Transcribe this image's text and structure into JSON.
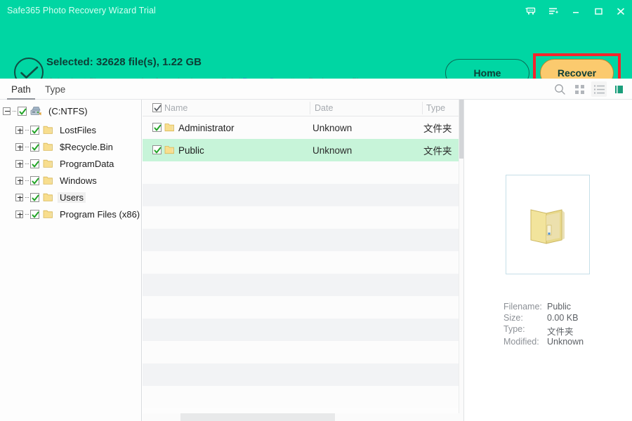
{
  "window": {
    "title": "Safe365 Photo Recovery Wizard Trial",
    "controls": [
      {
        "name": "cart-icon",
        "label": "Cart"
      },
      {
        "name": "feedback-icon",
        "label": "Feedback"
      },
      {
        "name": "minimize-icon",
        "label": "Minimize"
      },
      {
        "name": "maximize-icon",
        "label": "Maximize"
      },
      {
        "name": "close-icon",
        "label": "Close"
      }
    ],
    "accent_color": "#00d6a3",
    "highlight_color": "#f5232b"
  },
  "header": {
    "status_icon": "check-circle-icon",
    "selected_text": "Selected: 32628 file(s), 1.22 GB",
    "hint_prefix": "If the lost files cannot be found, please click \"",
    "hint_link": "Deep Scan",
    "hint_suffix": "\" to find more files.",
    "home_label": "Home",
    "recover_label": "Recover",
    "recover_color": "#fbca6e"
  },
  "tabs": [
    {
      "id": "path",
      "label": "Path",
      "active": true
    },
    {
      "id": "type",
      "label": "Type",
      "active": false
    }
  ],
  "toolbar": [
    {
      "name": "search-icon",
      "label": "Search",
      "selected": false
    },
    {
      "name": "grid-view-icon",
      "label": "Grid view",
      "selected": false
    },
    {
      "name": "list-view-icon",
      "label": "List view",
      "selected": true
    },
    {
      "name": "preview-panel-icon",
      "label": "Preview panel",
      "selected": false
    }
  ],
  "tree": {
    "root": {
      "label": "(C:NTFS)",
      "icon": "drive-icon",
      "checked": true,
      "expanded": true
    },
    "children": [
      {
        "label": "LostFiles",
        "icon": "folder-icon",
        "checked": true,
        "expanded": false,
        "selected": false
      },
      {
        "label": "$Recycle.Bin",
        "icon": "folder-icon",
        "checked": true,
        "expanded": false,
        "selected": false
      },
      {
        "label": "ProgramData",
        "icon": "folder-icon",
        "checked": true,
        "expanded": false,
        "selected": false
      },
      {
        "label": "Windows",
        "icon": "folder-icon",
        "checked": true,
        "expanded": false,
        "selected": false
      },
      {
        "label": "Users",
        "icon": "folder-icon",
        "checked": true,
        "expanded": false,
        "selected": true
      },
      {
        "label": "Program Files (x86)",
        "icon": "folder-icon",
        "checked": true,
        "expanded": false,
        "selected": false
      }
    ]
  },
  "filelist": {
    "columns": [
      {
        "id": "name",
        "label": "Name"
      },
      {
        "id": "date",
        "label": "Date"
      },
      {
        "id": "type",
        "label": "Type"
      }
    ],
    "header_checked": true,
    "rows": [
      {
        "name": "Administrator",
        "date": "Unknown",
        "type": "文件夹",
        "checked": true,
        "selected": false
      },
      {
        "name": "Public",
        "date": "Unknown",
        "type": "文件夹",
        "checked": true,
        "selected": true
      }
    ],
    "empty_row_count": 11
  },
  "preview": {
    "thumbnail_icon": "open-folder-icon",
    "fields": [
      {
        "key": "Filename:",
        "value": "Public"
      },
      {
        "key": "Size:",
        "value": "0.00 KB"
      },
      {
        "key": "Type:",
        "value": "文件夹"
      },
      {
        "key": "Modified:",
        "value": "Unknown"
      }
    ]
  }
}
